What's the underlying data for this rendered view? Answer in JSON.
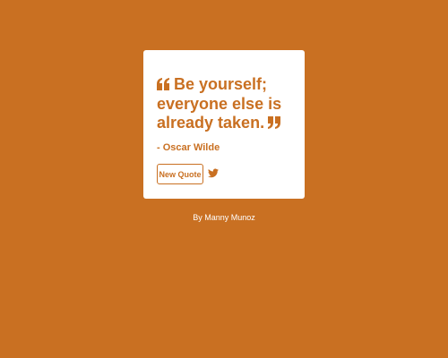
{
  "quote": {
    "text": "Be yourself; everyone else is already taken.",
    "author": "- Oscar Wilde",
    "open_icon": "open-quote-icon",
    "close_icon": "close-quote-icon"
  },
  "controls": {
    "new_quote_label": "New Quote",
    "tweet_icon": "twitter-icon"
  },
  "footer": {
    "credit": "By Manny Munoz"
  },
  "colors": {
    "background": "#c97022",
    "card": "#ffffff",
    "accent": "#c97022"
  }
}
